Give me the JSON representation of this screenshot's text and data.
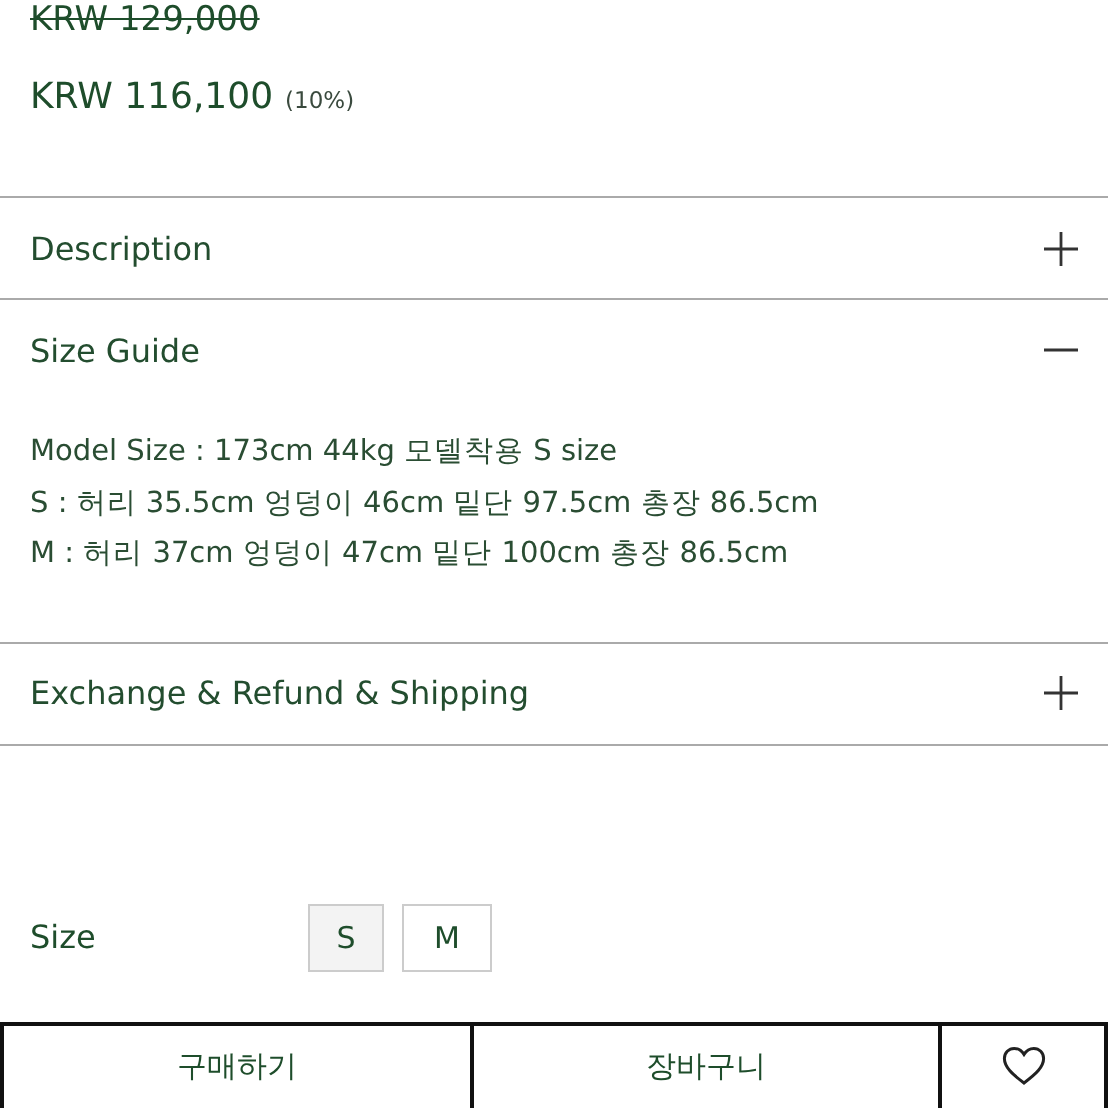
{
  "price": {
    "original": "KRW 129,000",
    "sale": "KRW 116,100",
    "discount": "(10%)"
  },
  "sections": [
    {
      "title": "Description",
      "expanded": false
    },
    {
      "title": "Size Guide",
      "expanded": true,
      "lines": [
        "Model Size : 173cm 44kg 모델착용 S size",
        "S : 허리 35.5cm 엉덩이 46cm 밑단 97.5cm 총장 86.5cm",
        "M : 허리 37cm 엉덩이 47cm 밑단 100cm 총장 86.5cm"
      ]
    },
    {
      "title": "Exchange & Refund & Shipping",
      "expanded": false
    }
  ],
  "size": {
    "label": "Size",
    "options": [
      {
        "label": "S",
        "selected": true
      },
      {
        "label": "M",
        "selected": false
      }
    ]
  },
  "actions": {
    "buy": "구매하기",
    "cart": "장바구니"
  }
}
